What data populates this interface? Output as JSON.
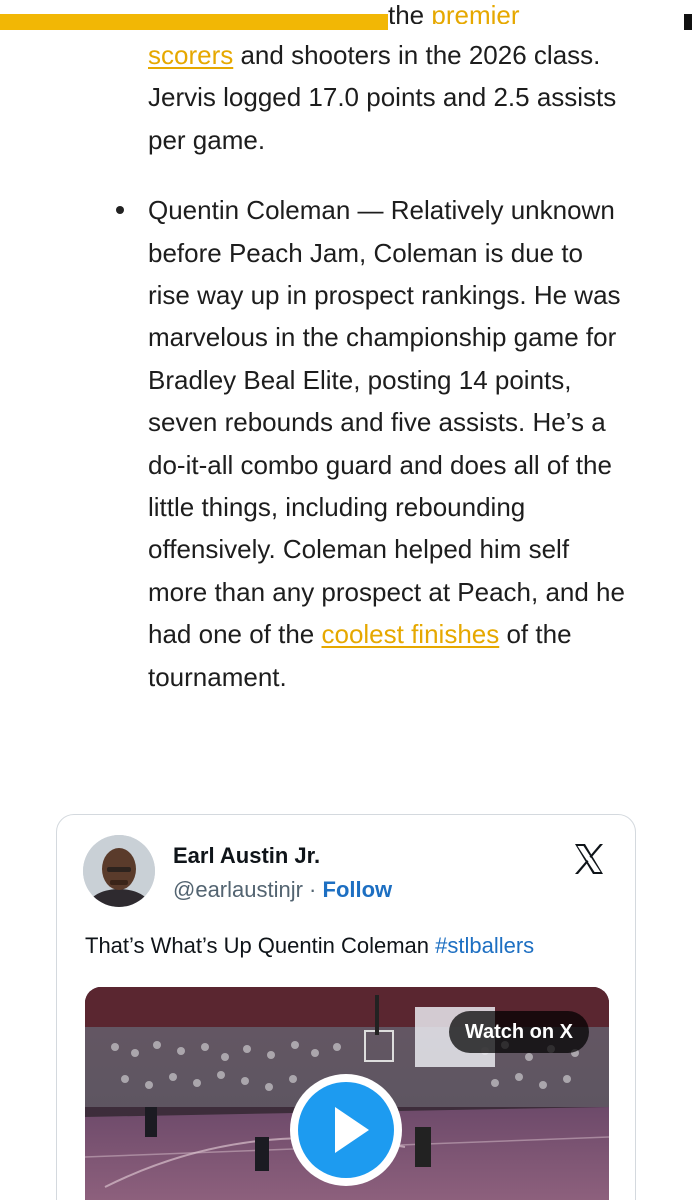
{
  "progress": {
    "fraction": 0.56,
    "accent": "#f2b705"
  },
  "article": {
    "clipped_link_text": "premier",
    "para1": {
      "pre_visible": "the ",
      "link": "scorers",
      "text": " and shooters in the 2026 class. Jervis logged 17.0 points and 2.5 assists per game."
    },
    "bullet2": {
      "text_before_link": "Quentin Coleman — Relatively unknown before Peach Jam, Coleman is due to rise way up in prospect rankings. He was marvelous in the championship game for Bradley Beal Elite, posting 14 points, seven rebounds and five assists. He’s a do-it-all combo guard and does all of the little things, including rebounding offensively. Coleman helped him self more than any prospect at Peach, and he had one of the ",
      "link": "coolest finishes",
      "text_after_link": " of the tournament."
    },
    "link_color": "#e6a800"
  },
  "tweet": {
    "author_name": "Earl Austin Jr.",
    "handle": "@earlaustinjr",
    "separator": " · ",
    "follow_label": "Follow",
    "text": "That’s What’s Up Quentin Coleman ",
    "hashtag": "#stlballers",
    "watch_label": "Watch on X",
    "icons": {
      "platform": "x-logo-icon",
      "play": "play-icon"
    },
    "accent": "#1d6fc2"
  }
}
